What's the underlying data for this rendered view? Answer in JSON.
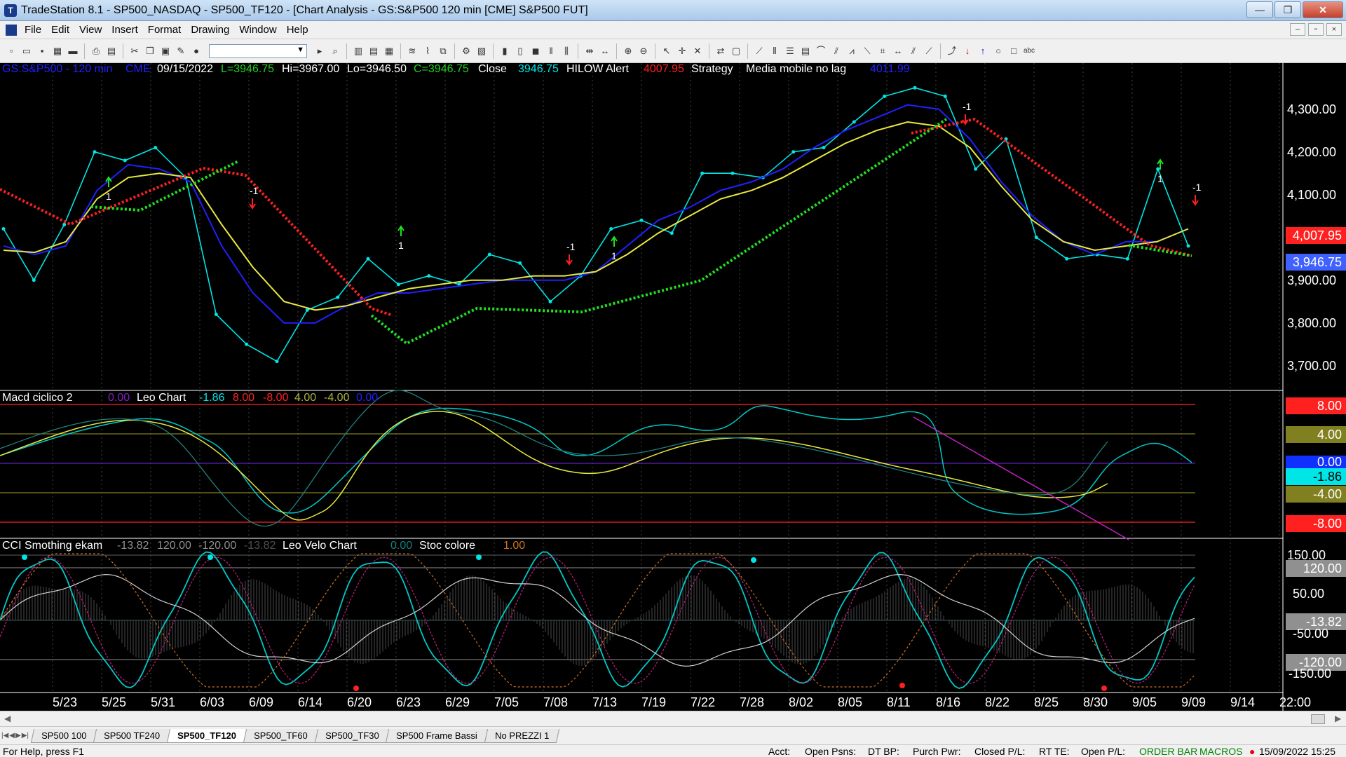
{
  "window": {
    "title": "TradeStation 8.1 - SP500_NASDAQ - SP500_TF120 - [Chart Analysis - GS:S&P500  120 min  [CME] S&P500 FUT]",
    "minimize": "—",
    "maximize": "❐",
    "close": "✕"
  },
  "menu": {
    "items": [
      "File",
      "Edit",
      "View",
      "Insert",
      "Format",
      "Drawing",
      "Window",
      "Help"
    ]
  },
  "chart_header": {
    "symbol": "GS:S&P500 - 120 min",
    "exchange": "CME",
    "date": "09/15/2022",
    "last": "L=3946.75",
    "hi": "Hi=3967.00",
    "lo": "Lo=3946.50",
    "c": "C=3946.75",
    "close_label": "Close",
    "close_value": "3946.75",
    "hilow_label": "HILOW Alert",
    "hilow_value": "4007.95",
    "strategy": "Strategy",
    "media": "Media mobile no lag",
    "media_value": "4011.99"
  },
  "macd_header": {
    "name": "Macd ciclico 2",
    "v1": "0.00",
    "leo": "Leo Chart",
    "v2": "-1.86",
    "v3": "8.00",
    "v4": "-8.00",
    "v5": "4.00",
    "v6": "-4.00",
    "v7": "0.00"
  },
  "cci_header": {
    "name": "CCI Smothing ekam",
    "v1": "-13.82",
    "v2": "120.00",
    "v3": "-120.00",
    "v4": "-13.82",
    "leo": "Leo Velo Chart",
    "v5": "0.00",
    "stoc": "Stoc colore",
    "v6": "1.00"
  },
  "price_axis": {
    "labels": [
      "4,300.00",
      "4,200.00",
      "4,100.00",
      "3,900.00",
      "3,800.00",
      "3,700.00"
    ],
    "hilow_box": "4,007.95",
    "close_box": "3,946.75"
  },
  "macd_axis": {
    "labels": [
      "8.00",
      "4.00",
      "0.00",
      "-1.86",
      "-4.00",
      "-8.00"
    ]
  },
  "cci_axis": {
    "labels": [
      "150.00",
      "120.00",
      "50.00",
      "-13.82",
      "-50.00",
      "-120.00",
      "-150.00"
    ]
  },
  "date_axis": {
    "labels": [
      "5/23",
      "5/25",
      "5/31",
      "6/03",
      "6/09",
      "6/14",
      "6/20",
      "6/23",
      "6/29",
      "7/05",
      "7/08",
      "7/13",
      "7/19",
      "7/22",
      "7/28",
      "8/02",
      "8/05",
      "8/11",
      "8/16",
      "8/22",
      "8/25",
      "8/30",
      "9/05",
      "9/09",
      "9/14",
      "22:00"
    ]
  },
  "signals": {
    "long": "1",
    "short": "-1"
  },
  "chart_data": {
    "type": "line",
    "title": "",
    "price_ylim": [
      3640,
      4345
    ],
    "x_labels": [
      "5/23",
      "5/25",
      "5/31",
      "6/03",
      "6/09",
      "6/14",
      "6/20",
      "6/23",
      "6/29",
      "7/05",
      "7/08",
      "7/13",
      "7/19",
      "7/22",
      "7/28",
      "8/02",
      "8/05",
      "8/11",
      "8/16",
      "8/22",
      "8/25",
      "8/30",
      "9/05",
      "9/09",
      "9/14"
    ],
    "series": [
      {
        "color": "#00e5e5",
        "values": [
          3990,
          3870,
          4000,
          4170,
          4150,
          4180,
          4110,
          3790,
          3720,
          3680,
          3800,
          3830,
          3920,
          3860,
          3880,
          3860,
          3930,
          3910,
          3820,
          3880,
          3990,
          4010,
          3980,
          4120,
          4120,
          4110,
          4170,
          4180,
          4240,
          4300,
          4320,
          4300,
          4130,
          4200,
          3970,
          3920,
          3930,
          3920,
          4130,
          3950
        ]
      },
      {
        "color": "#2020ff",
        "values": [
          3950,
          3930,
          3950,
          4080,
          4140,
          4130,
          4100,
          3950,
          3840,
          3770,
          3770,
          3810,
          3840,
          3840,
          3850,
          3860,
          3870,
          3870,
          3870,
          3890,
          3950,
          4010,
          4040,
          4080,
          4100,
          4130,
          4180,
          4220,
          4250,
          4280,
          4270,
          4200,
          4100,
          4020,
          3960,
          3930,
          3960,
          3960,
          3990
        ]
      },
      {
        "color": "#e8e840",
        "values": [
          3940,
          3935,
          3960,
          4060,
          4110,
          4120,
          4110,
          4000,
          3900,
          3820,
          3800,
          3810,
          3830,
          3850,
          3860,
          3870,
          3870,
          3880,
          3880,
          3890,
          3930,
          3980,
          4020,
          4060,
          4080,
          4110,
          4150,
          4190,
          4220,
          4240,
          4230,
          4180,
          4090,
          4010,
          3960,
          3940,
          3950,
          3960,
          3990
        ]
      },
      {
        "color": "#ff2020",
        "values": [
          4070,
          4000
        ]
      },
      {
        "color": "#20e020",
        "values": [
          3960,
          4060
        ]
      }
    ]
  }
}
